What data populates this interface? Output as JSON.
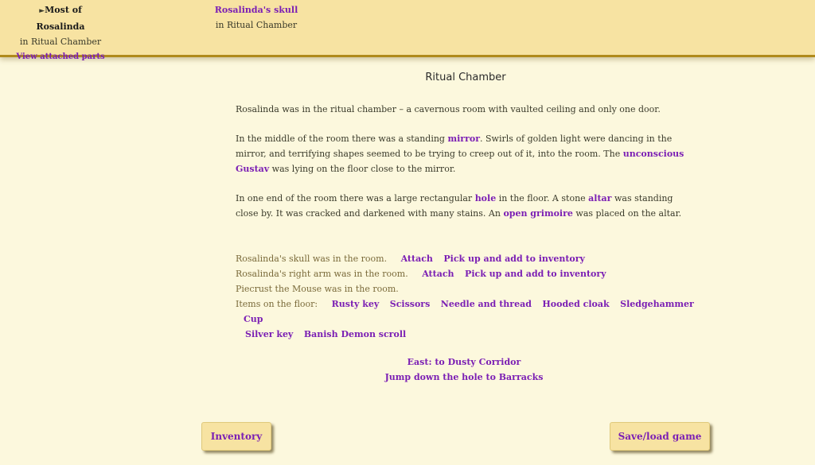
{
  "characters": [
    {
      "arrow": "►",
      "name": "Most of Rosalinda",
      "location": "in Ritual Chamber",
      "view_link": "View attached parts",
      "selected": true
    },
    {
      "name": "Rosalinda's skull",
      "location": "in Ritual Chamber",
      "selected": false
    }
  ],
  "room": {
    "title": "Ritual Chamber",
    "para1": "Rosalinda was in the ritual chamber – a cavernous room with vaulted ceiling and only one door.",
    "para2": {
      "t1": "In the middle of the room there was a standing ",
      "l1": "mirror",
      "t2": ". Swirls of golden light were dancing in the mirror, and terrifying shapes seemed to be trying to creep out of it, into the room. The ",
      "l2": "unconscious Gustav",
      "t3": " was lying on the floor close to the mirror."
    },
    "para3": {
      "t1": "In one end of the room there was a large rectangular ",
      "l1": "hole",
      "t2": " in the floor. A stone ",
      "l2": "altar",
      "t3": " was standing close by. It was cracked and darkened with many stains. An ",
      "l3": "open grimoire",
      "t4": " was placed on the altar."
    }
  },
  "things": [
    {
      "text": "Rosalinda's skull was in the room.",
      "actions": [
        "Attach",
        "Pick up and add to inventory"
      ]
    },
    {
      "text": "Rosalinda's right arm was in the room.",
      "actions": [
        "Attach",
        "Pick up and add to inventory"
      ]
    },
    {
      "text": "Piecrust the Mouse was in the room.",
      "actions": []
    }
  ],
  "floor": {
    "label": "Items on the floor:",
    "items": [
      "Rusty key",
      "Scissors",
      "Needle and thread",
      "Hooded cloak",
      "Sledgehammer",
      "Cup",
      "Silver key",
      "Banish Demon scroll"
    ]
  },
  "exits": [
    "East: to Dusty Corridor",
    "Jump down the hole to Barracks"
  ],
  "buttons": {
    "inventory": "Inventory",
    "save_load": "Save/load game"
  },
  "colors": {
    "link": "#7b1fb4",
    "header_bg": "#f7e3a2",
    "page_bg": "#fcf8dd",
    "header_border": "#b08a1c"
  }
}
